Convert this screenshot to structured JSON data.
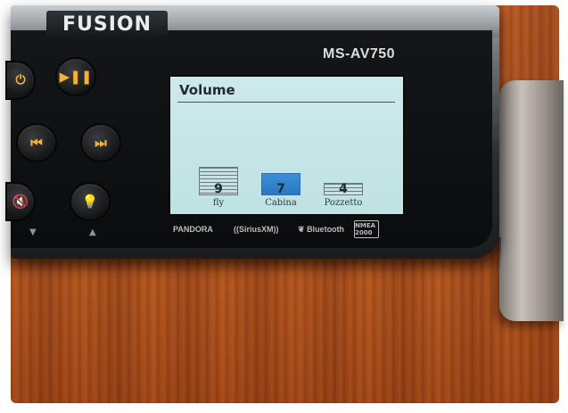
{
  "device": {
    "brand": "FUSION",
    "model": "MS-AV750"
  },
  "screen": {
    "title": "Volume",
    "zones": [
      {
        "name": "fly",
        "value": "9",
        "level": 0.9,
        "selected": false
      },
      {
        "name": "Cabina",
        "value": "7",
        "level": 0.7,
        "selected": true
      },
      {
        "name": "Pozzetto",
        "value": "4",
        "level": 0.4,
        "selected": false
      }
    ]
  },
  "buttons": {
    "play_pause_icon": "play-pause-icon",
    "prev_icon": "previous-icon",
    "next_icon": "next-icon",
    "mute_icon": "mute-icon",
    "light_icon": "brightness-icon",
    "power_icon": "power-icon"
  },
  "logos": {
    "pandora": "PANDORA",
    "siriusxm": "((SiriusXM))",
    "bluetooth": "Bluetooth",
    "nmea": "NMEA 2000"
  },
  "colors": {
    "accent": "#f2b233",
    "screen_bg": "#c8e6e6",
    "selected_zone": "#3a8fd6"
  }
}
